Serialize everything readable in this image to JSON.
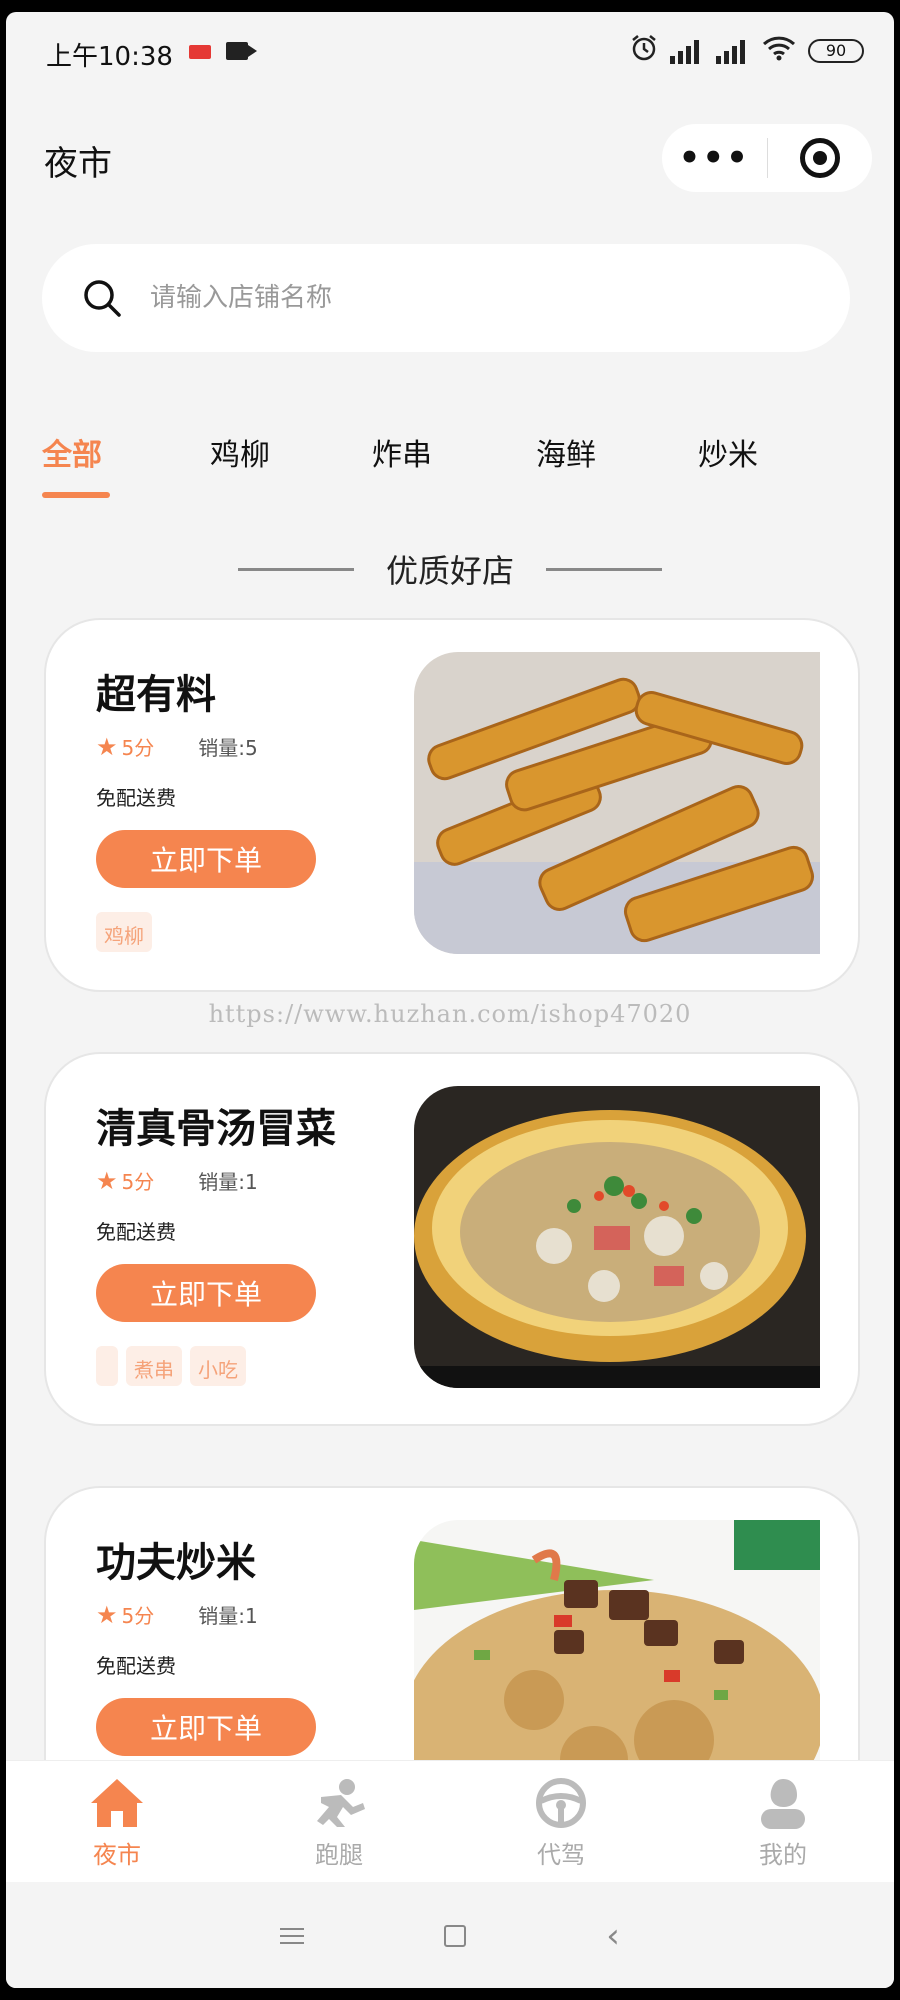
{
  "status_bar": {
    "time": "上午10:38",
    "battery": "90"
  },
  "navbar": {
    "title": "夜市",
    "more_label": "•••"
  },
  "search": {
    "placeholder": "请输入店铺名称"
  },
  "tabs": [
    {
      "label": "全部",
      "active": true
    },
    {
      "label": "鸡柳",
      "active": false
    },
    {
      "label": "炸串",
      "active": false
    },
    {
      "label": "海鲜",
      "active": false
    },
    {
      "label": "炒米",
      "active": false
    }
  ],
  "section_title": "优质好店",
  "shops": [
    {
      "name": "超有料",
      "score": "5分",
      "sales": "销量:5",
      "delivery": "免配送费",
      "order_label": "立即下单",
      "tags": [
        "鸡柳"
      ]
    },
    {
      "name": "清真骨汤冒菜",
      "score": "5分",
      "sales": "销量:1",
      "delivery": "免配送费",
      "order_label": "立即下单",
      "tags": [
        "",
        "煮串",
        "小吃"
      ]
    },
    {
      "name": "功夫炒米",
      "score": "5分",
      "sales": "销量:1",
      "delivery": "免配送费",
      "order_label": "立即下单",
      "tags": []
    }
  ],
  "watermark": "https://www.huzhan.com/ishop47020",
  "tabbar": [
    {
      "label": "夜市",
      "icon": "home-icon",
      "active": true
    },
    {
      "label": "跑腿",
      "icon": "runner-icon",
      "active": false
    },
    {
      "label": "代驾",
      "icon": "steering-wheel-icon",
      "active": false
    },
    {
      "label": "我的",
      "icon": "user-icon",
      "active": false
    }
  ],
  "colors": {
    "accent": "#f5854f",
    "tag_bg": "#fdeee6",
    "page_bg": "#f4f4f4"
  }
}
